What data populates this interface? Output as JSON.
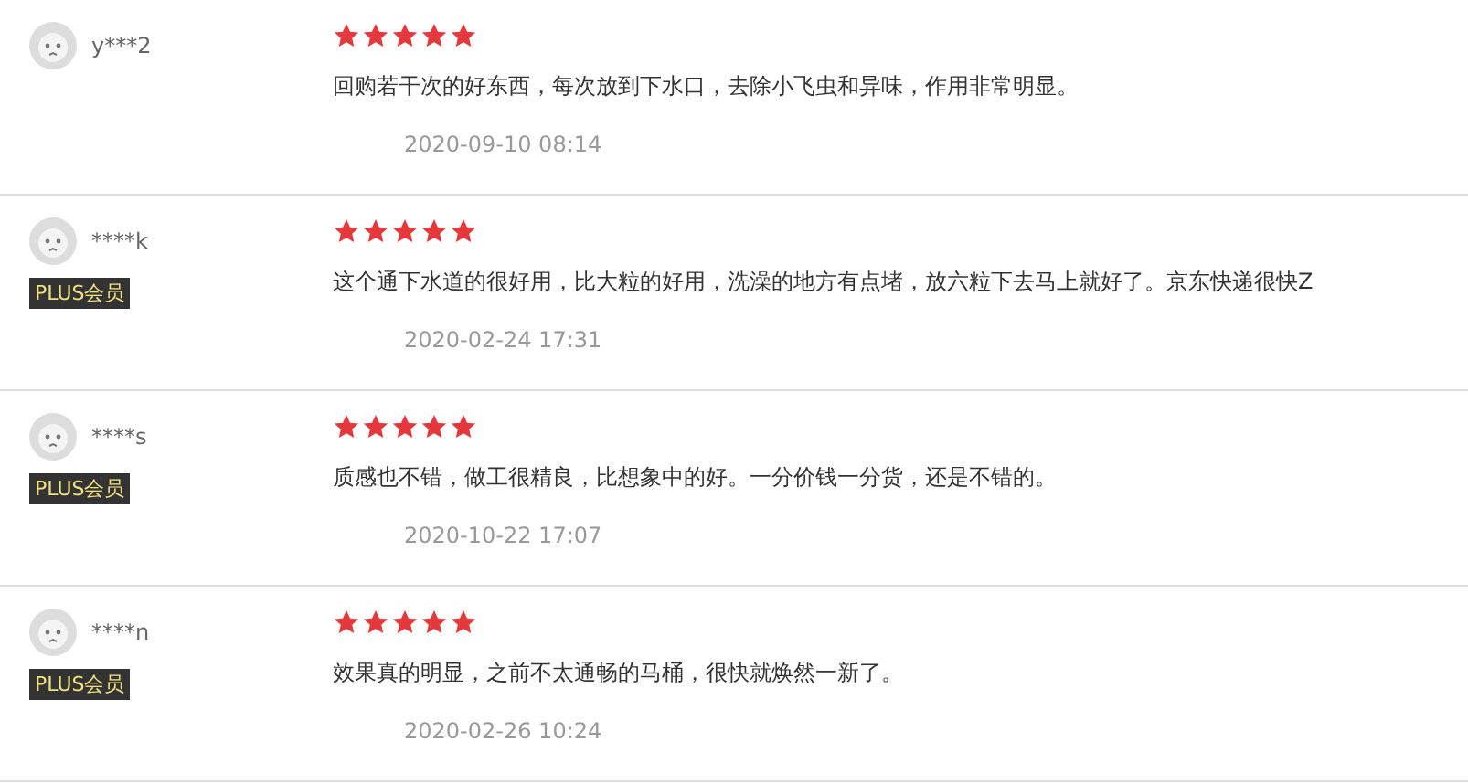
{
  "reviews": [
    {
      "user": "y***2",
      "plus": false,
      "stars": 5,
      "text": "回购若干次的好东西，每次放到下水口，去除小飞虫和异味，作用非常明显。",
      "date": "2020-09-10 08:14"
    },
    {
      "user": "****k",
      "plus": true,
      "badge": "PLUS会员",
      "stars": 5,
      "text": "这个通下水道的很好用，比大粒的好用，洗澡的地方有点堵，放六粒下去马上就好了。京东快递很快Z",
      "date": "2020-02-24 17:31"
    },
    {
      "user": "****s",
      "plus": true,
      "badge": "PLUS会员",
      "stars": 5,
      "text": "质感也不错，做工很精良，比想象中的好。一分价钱一分货，还是不错的。",
      "date": "2020-10-22 17:07"
    },
    {
      "user": "****n",
      "plus": true,
      "badge": "PLUS会员",
      "stars": 5,
      "text": "效果真的明显，之前不太通畅的马桶，很快就焕然一新了。",
      "date": "2020-02-26 10:24"
    }
  ]
}
